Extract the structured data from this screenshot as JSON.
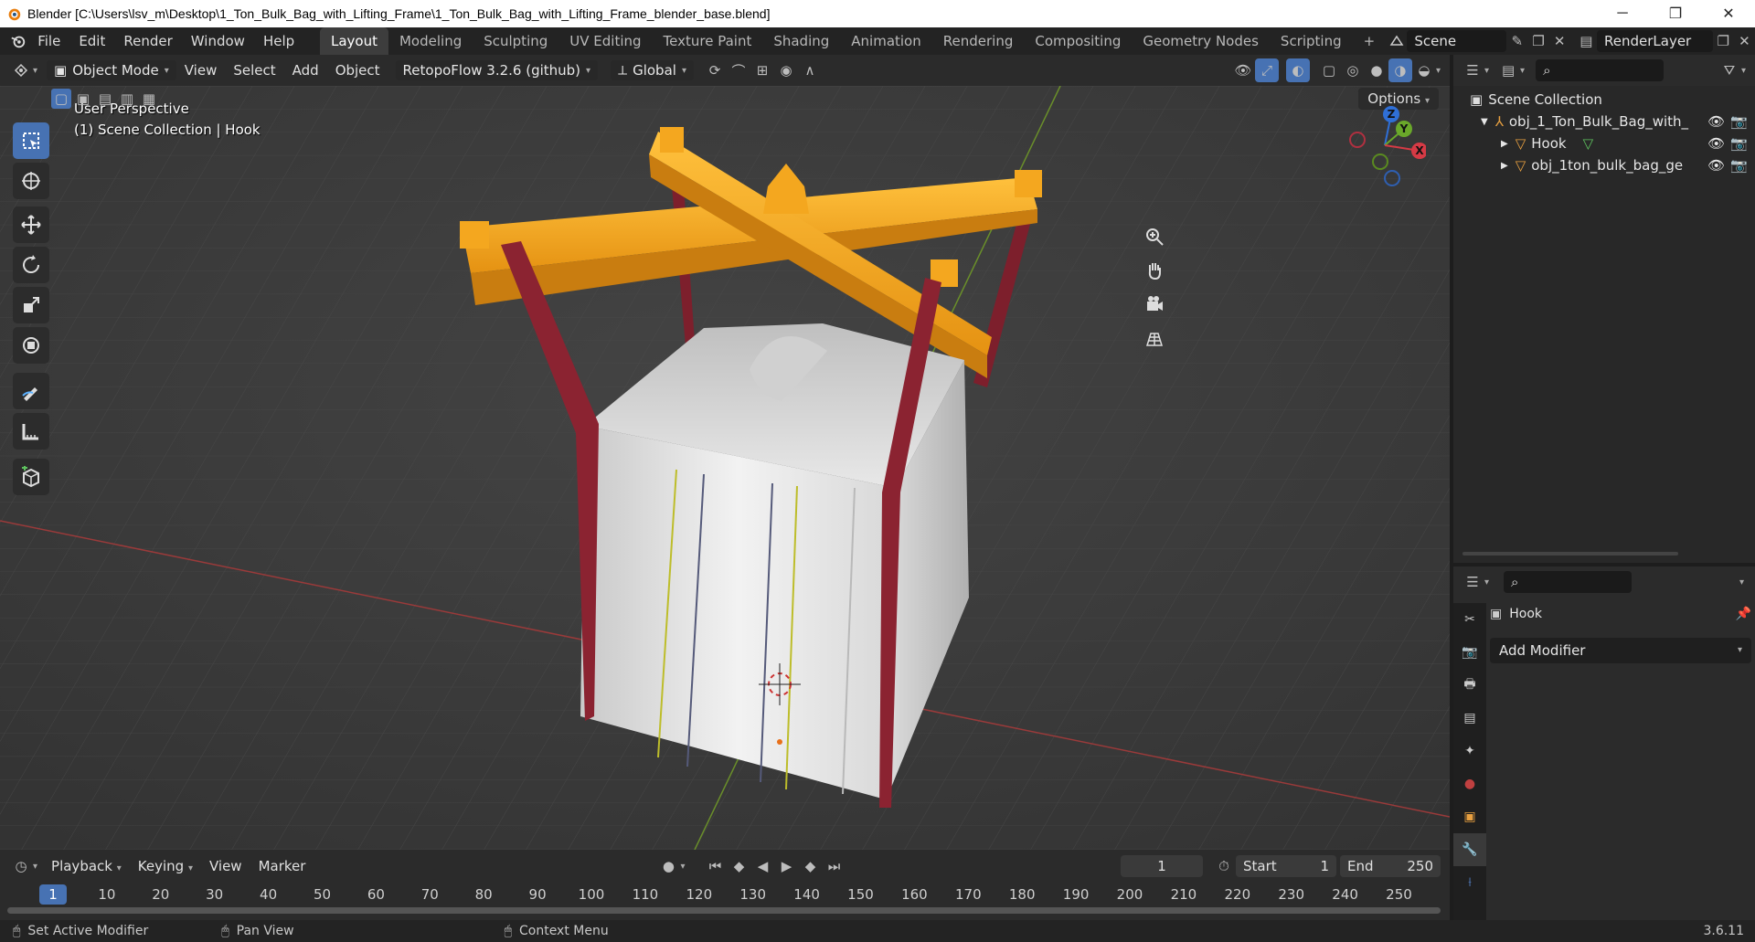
{
  "window": {
    "title": "Blender [C:\\Users\\lsv_m\\Desktop\\1_Ton_Bulk_Bag_with_Lifting_Frame\\1_Ton_Bulk_Bag_with_Lifting_Frame_blender_base.blend]",
    "minimize": "─",
    "maximize": "❐",
    "close": "✕"
  },
  "menu": [
    "File",
    "Edit",
    "Render",
    "Window",
    "Help"
  ],
  "workspaces": [
    "Layout",
    "Modeling",
    "Sculpting",
    "UV Editing",
    "Texture Paint",
    "Shading",
    "Animation",
    "Rendering",
    "Compositing",
    "Geometry Nodes",
    "Scripting"
  ],
  "workspace_add": "+",
  "scene": {
    "name": "Scene",
    "view_layer": "RenderLayer"
  },
  "viewport_header": {
    "mode": "Object Mode",
    "menus": [
      "View",
      "Select",
      "Add",
      "Object"
    ],
    "addon": "RetopoFlow 3.2.6 (github)",
    "orientation": "Global"
  },
  "viewport": {
    "perspective": "User Perspective",
    "collection_info": "(1) Scene Collection | Hook",
    "options": "Options",
    "gizmo": {
      "x": "X",
      "y": "Y",
      "z": "Z"
    }
  },
  "timeline": {
    "menus": [
      "Playback",
      "Keying",
      "View",
      "Marker"
    ],
    "current_frame": "1",
    "start_label": "Start",
    "start": "1",
    "end_label": "End",
    "end": "250",
    "ruler": [
      "1",
      "10",
      "20",
      "30",
      "40",
      "50",
      "60",
      "70",
      "80",
      "90",
      "100",
      "110",
      "120",
      "130",
      "140",
      "150",
      "160",
      "170",
      "180",
      "190",
      "200",
      "210",
      "220",
      "230",
      "240",
      "250"
    ]
  },
  "statusbar": {
    "left": "Set Active Modifier",
    "middle": "Pan View",
    "right": "Context Menu",
    "version": "3.6.11"
  },
  "outliner": {
    "root": "Scene Collection",
    "items": [
      {
        "name": "obj_1_Ton_Bulk_Bag_with_",
        "type": "empty"
      },
      {
        "name": "Hook",
        "type": "mesh"
      },
      {
        "name": "obj_1ton_bulk_bag_ge",
        "type": "mesh"
      }
    ]
  },
  "properties": {
    "object_name": "Hook",
    "add_modifier": "Add Modifier"
  },
  "colors": {
    "accent": "#4772b3",
    "frame_orange": "#f5a623",
    "strap_red": "#8b2331",
    "bag_white": "#e6e6e6"
  }
}
